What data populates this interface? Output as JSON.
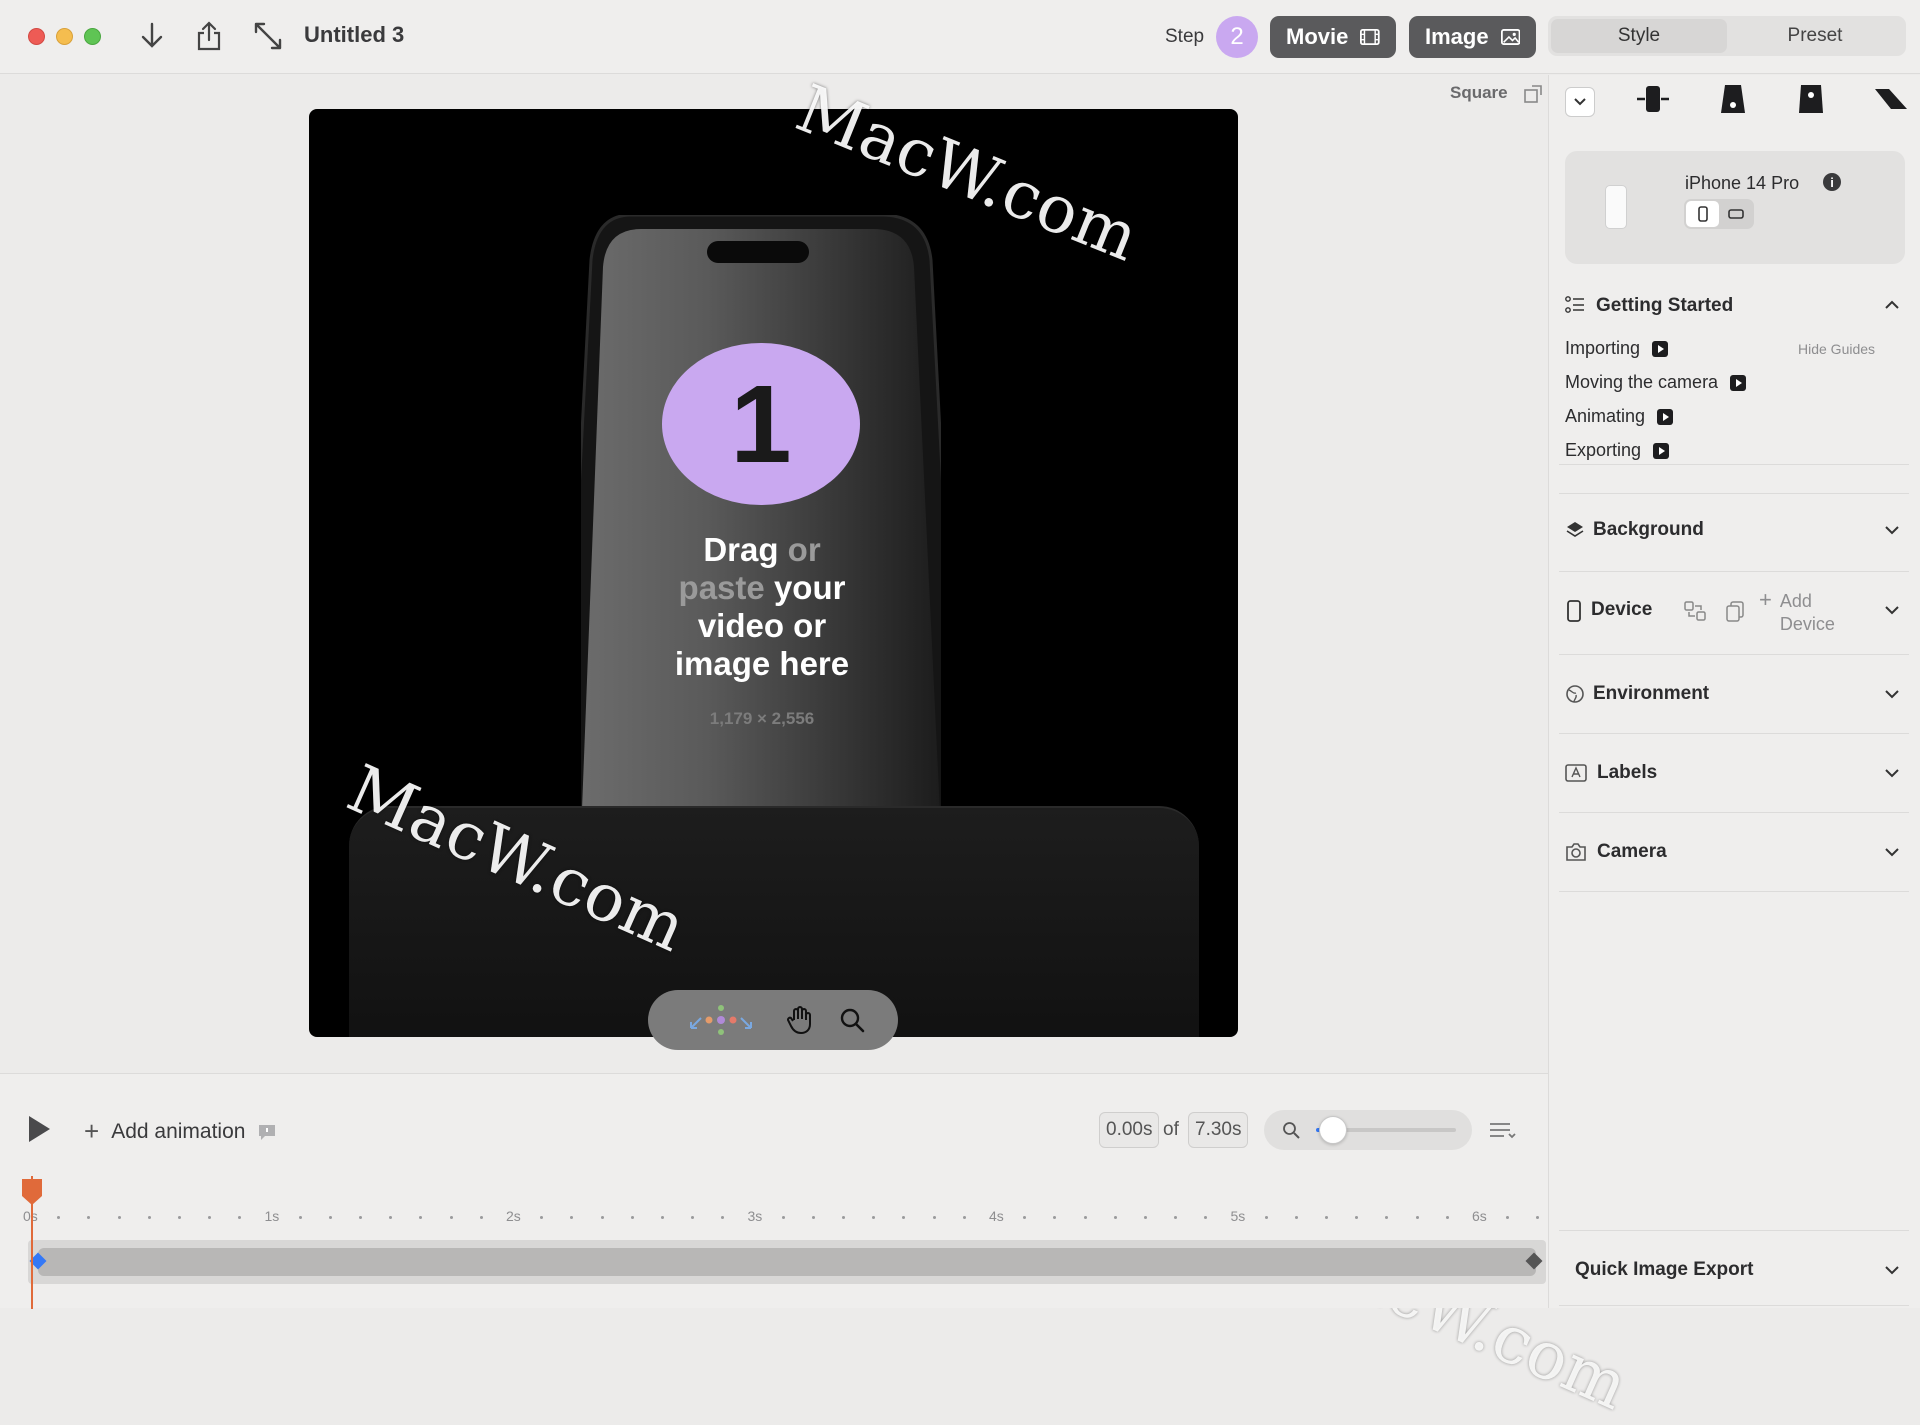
{
  "window": {
    "title": "Untitled 3"
  },
  "toolbar": {
    "step_label": "Step",
    "step_number": "2",
    "movie_label": "Movie",
    "image_label": "Image",
    "tabs": [
      "Style",
      "Preset"
    ]
  },
  "canvas": {
    "aspect_label": "Square",
    "drop_number": "1",
    "drop_text": {
      "w1": "Drag",
      "w2": "or",
      "w3": "paste",
      "w4": "your",
      "w5": "video or",
      "w6": "image here"
    },
    "drop_dimensions": "1,179 × 2,556"
  },
  "sidebar": {
    "device_name": "iPhone 14 Pro",
    "getting_started": {
      "title": "Getting Started",
      "hide_guides": "Hide Guides",
      "items": [
        "Importing",
        "Moving the camera",
        "Animating",
        "Exporting"
      ]
    },
    "sections": {
      "background": "Background",
      "device": "Device",
      "add_device": "Add Device",
      "environment": "Environment",
      "labels": "Labels",
      "camera": "Camera",
      "quick_export": "Quick Image Export"
    }
  },
  "timeline": {
    "add_animation": "Add animation",
    "current_time": "0.00s",
    "of_label": "of",
    "total_time": "7.30s",
    "zoom_fraction": 0.12,
    "ruler": [
      "0s",
      "1s",
      "2s",
      "3s",
      "4s",
      "5s",
      "6s"
    ]
  },
  "watermark": "MacW.com",
  "colors": {
    "accent": "#c9a8f0",
    "playhead": "#e06a3a",
    "keyframe": "#3478f6"
  }
}
